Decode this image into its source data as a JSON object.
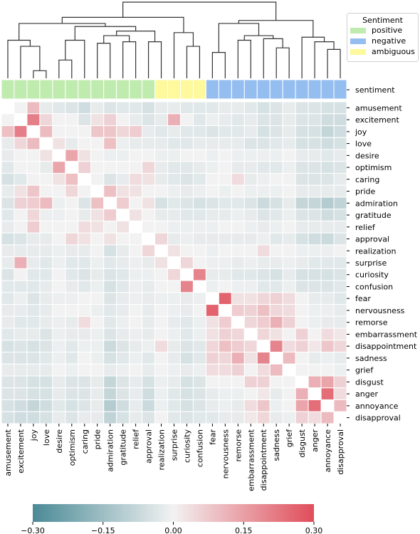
{
  "chart_data": {
    "type": "heatmap",
    "title": "",
    "labels": [
      "amusement",
      "excitement",
      "joy",
      "love",
      "desire",
      "optimism",
      "caring",
      "pride",
      "admiration",
      "gratitude",
      "relief",
      "approval",
      "realization",
      "surprise",
      "curiosity",
      "confusion",
      "fear",
      "nervousness",
      "remorse",
      "embarrassment",
      "disappointment",
      "sadness",
      "grief",
      "disgust",
      "anger",
      "annoyance",
      "disapproval"
    ],
    "row_annotation_label": "sentiment",
    "sentiment": [
      "positive",
      "positive",
      "positive",
      "positive",
      "positive",
      "positive",
      "positive",
      "positive",
      "positive",
      "positive",
      "positive",
      "positive",
      "ambiguous",
      "ambiguous",
      "ambiguous",
      "ambiguous",
      "negative",
      "negative",
      "negative",
      "negative",
      "negative",
      "negative",
      "negative",
      "negative",
      "negative",
      "negative",
      "negative"
    ],
    "legend": {
      "title": "Sentiment",
      "placement": "top-right",
      "entries": [
        {
          "label": "positive",
          "color": "#c0ebae"
        },
        {
          "label": "negative",
          "color": "#94bdf0"
        },
        {
          "label": "ambiguous",
          "color": "#fdf99c"
        }
      ]
    },
    "colorbar": {
      "vmin": -0.3,
      "vmax": 0.3,
      "ticks": [
        "−0.30",
        "−0.15",
        "0.00",
        "0.15",
        "0.30"
      ],
      "tick_values": [
        -0.3,
        -0.15,
        0.0,
        0.15,
        0.3
      ],
      "low_color": "#4a8a96",
      "mid_color": "#f2f2f2",
      "high_color": "#e04d5a",
      "placement": "bottom"
    },
    "diagonal_masked": true,
    "matrix": [
      [
        null,
        0.0,
        0.1,
        -0.02,
        -0.03,
        -0.04,
        -0.06,
        -0.02,
        -0.04,
        -0.03,
        -0.03,
        -0.05,
        -0.02,
        -0.02,
        -0.03,
        -0.03,
        -0.03,
        -0.02,
        -0.02,
        -0.03,
        -0.05,
        -0.04,
        -0.02,
        -0.04,
        -0.04,
        -0.05,
        -0.05
      ],
      [
        0.0,
        null,
        0.21,
        0.05,
        0.0,
        0.0,
        -0.04,
        0.03,
        0.06,
        0.0,
        -0.02,
        -0.04,
        -0.02,
        0.12,
        0.0,
        -0.03,
        -0.01,
        -0.02,
        -0.03,
        -0.02,
        -0.04,
        -0.04,
        -0.02,
        -0.04,
        -0.04,
        -0.06,
        -0.06
      ],
      [
        0.09,
        0.21,
        null,
        0.1,
        0.0,
        0.0,
        0.0,
        0.08,
        0.08,
        0.05,
        0.07,
        -0.02,
        -0.03,
        -0.02,
        -0.03,
        -0.03,
        -0.04,
        -0.03,
        -0.03,
        -0.02,
        -0.05,
        -0.04,
        -0.02,
        -0.05,
        -0.05,
        -0.08,
        -0.06
      ],
      [
        -0.02,
        0.05,
        0.1,
        null,
        0.03,
        -0.02,
        0.0,
        0.0,
        0.09,
        -0.01,
        -0.02,
        -0.02,
        -0.02,
        -0.03,
        -0.03,
        -0.02,
        -0.02,
        -0.02,
        -0.02,
        -0.04,
        -0.04,
        -0.03,
        -0.02,
        -0.05,
        -0.05,
        -0.06,
        -0.05
      ],
      [
        -0.02,
        0.0,
        0.0,
        0.03,
        null,
        0.14,
        0.03,
        0.0,
        -0.01,
        -0.01,
        0.0,
        0.0,
        -0.01,
        -0.01,
        0.0,
        0.0,
        -0.01,
        0.0,
        -0.01,
        -0.01,
        -0.01,
        -0.01,
        0.0,
        -0.02,
        -0.02,
        -0.03,
        -0.02
      ],
      [
        -0.03,
        0.0,
        0.0,
        -0.02,
        0.14,
        null,
        0.06,
        0.0,
        0.0,
        0.0,
        0.0,
        0.05,
        -0.02,
        -0.03,
        -0.03,
        -0.02,
        -0.01,
        0.0,
        -0.02,
        -0.02,
        -0.03,
        -0.03,
        -0.01,
        -0.04,
        -0.04,
        -0.05,
        -0.04
      ],
      [
        -0.05,
        -0.03,
        0.0,
        0.0,
        0.03,
        0.09,
        null,
        0.0,
        -0.04,
        -0.02,
        0.04,
        0.03,
        -0.02,
        -0.03,
        -0.04,
        -0.03,
        0.0,
        0.0,
        0.04,
        -0.02,
        -0.01,
        0.0,
        0.0,
        -0.04,
        -0.04,
        -0.04,
        -0.02
      ],
      [
        -0.02,
        0.03,
        0.08,
        0.0,
        0.0,
        0.05,
        0.0,
        null,
        0.09,
        0.03,
        0.03,
        0.0,
        0.0,
        -0.01,
        -0.02,
        -0.01,
        0.0,
        -0.01,
        0.0,
        -0.01,
        -0.01,
        -0.01,
        0.0,
        -0.02,
        -0.02,
        -0.02,
        -0.02
      ],
      [
        -0.04,
        0.06,
        0.07,
        0.1,
        -0.01,
        0.0,
        -0.04,
        0.09,
        null,
        0.07,
        0.0,
        0.03,
        -0.05,
        -0.03,
        -0.04,
        -0.05,
        -0.04,
        -0.03,
        -0.03,
        -0.04,
        -0.07,
        -0.05,
        -0.02,
        -0.08,
        -0.08,
        -0.11,
        -0.09
      ],
      [
        -0.03,
        0.0,
        0.05,
        -0.01,
        -0.01,
        0.0,
        -0.02,
        0.03,
        0.07,
        null,
        0.03,
        0.0,
        -0.02,
        -0.02,
        -0.03,
        -0.03,
        -0.02,
        -0.02,
        -0.01,
        -0.02,
        -0.04,
        -0.03,
        -0.01,
        -0.04,
        -0.04,
        -0.06,
        -0.05
      ],
      [
        -0.02,
        0.0,
        0.07,
        0.0,
        0.0,
        0.0,
        0.04,
        0.03,
        0.0,
        0.03,
        null,
        0.0,
        0.0,
        -0.01,
        -0.01,
        -0.01,
        -0.01,
        0.0,
        0.0,
        -0.01,
        -0.02,
        -0.01,
        0.0,
        -0.02,
        -0.02,
        -0.02,
        -0.02
      ],
      [
        -0.05,
        -0.04,
        -0.02,
        -0.02,
        0.0,
        0.05,
        0.03,
        0.0,
        0.03,
        0.0,
        0.0,
        null,
        0.05,
        -0.02,
        -0.01,
        -0.02,
        -0.02,
        -0.02,
        -0.02,
        -0.02,
        -0.01,
        -0.03,
        -0.02,
        -0.05,
        -0.06,
        -0.07,
        -0.04
      ],
      [
        -0.02,
        -0.02,
        -0.02,
        -0.02,
        -0.01,
        -0.02,
        -0.02,
        0.0,
        -0.05,
        -0.02,
        0.0,
        0.05,
        null,
        0.03,
        0.0,
        0.0,
        -0.01,
        0.0,
        0.0,
        0.0,
        0.04,
        0.0,
        0.0,
        -0.01,
        -0.01,
        -0.01,
        0.0
      ],
      [
        -0.02,
        0.12,
        -0.02,
        -0.03,
        -0.01,
        -0.03,
        -0.03,
        -0.01,
        -0.03,
        -0.02,
        -0.01,
        -0.02,
        0.03,
        null,
        0.05,
        0.0,
        -0.01,
        -0.01,
        -0.02,
        -0.01,
        -0.02,
        -0.02,
        -0.01,
        -0.02,
        -0.03,
        -0.03,
        -0.03
      ],
      [
        -0.04,
        0.0,
        -0.03,
        -0.03,
        0.0,
        -0.03,
        -0.04,
        -0.02,
        -0.04,
        -0.03,
        -0.01,
        -0.01,
        0.0,
        0.05,
        null,
        0.2,
        -0.02,
        -0.02,
        -0.03,
        -0.03,
        -0.04,
        -0.05,
        -0.02,
        -0.05,
        -0.05,
        -0.05,
        -0.04
      ],
      [
        -0.03,
        -0.03,
        -0.03,
        -0.02,
        0.0,
        -0.02,
        -0.03,
        -0.01,
        -0.05,
        -0.03,
        -0.01,
        -0.02,
        0.0,
        0.0,
        0.2,
        null,
        -0.01,
        0.0,
        -0.01,
        -0.01,
        -0.03,
        -0.03,
        -0.01,
        -0.04,
        -0.04,
        -0.04,
        -0.03
      ],
      [
        -0.03,
        -0.01,
        -0.04,
        -0.02,
        -0.01,
        -0.01,
        0.0,
        0.0,
        -0.04,
        -0.02,
        -0.01,
        -0.02,
        -0.01,
        -0.01,
        -0.02,
        -0.01,
        null,
        0.26,
        0.03,
        0.03,
        0.05,
        0.06,
        0.04,
        0.0,
        -0.02,
        -0.02,
        -0.03
      ],
      [
        -0.02,
        -0.02,
        -0.03,
        -0.02,
        0.0,
        0.0,
        0.0,
        -0.01,
        -0.03,
        -0.02,
        0.0,
        -0.02,
        0.0,
        -0.01,
        -0.02,
        0.0,
        0.26,
        null,
        0.07,
        0.06,
        0.09,
        0.05,
        0.04,
        0.0,
        -0.01,
        -0.01,
        -0.02
      ],
      [
        -0.02,
        -0.03,
        -0.03,
        -0.02,
        -0.01,
        -0.02,
        0.04,
        0.0,
        -0.03,
        -0.01,
        0.0,
        -0.02,
        0.0,
        -0.02,
        -0.03,
        -0.01,
        0.03,
        0.07,
        null,
        0.05,
        0.07,
        0.12,
        0.06,
        0.0,
        -0.01,
        -0.02,
        -0.02
      ],
      [
        -0.03,
        -0.02,
        -0.02,
        -0.04,
        -0.01,
        -0.02,
        -0.02,
        -0.01,
        -0.04,
        -0.02,
        -0.01,
        -0.02,
        0.0,
        -0.01,
        -0.03,
        -0.01,
        0.03,
        0.06,
        0.05,
        null,
        0.05,
        0.03,
        0.0,
        0.06,
        0.0,
        0.04,
        0.02
      ],
      [
        -0.05,
        -0.04,
        -0.05,
        -0.04,
        -0.01,
        -0.03,
        -0.01,
        -0.01,
        -0.07,
        -0.04,
        -0.02,
        -0.01,
        0.04,
        -0.02,
        -0.04,
        -0.03,
        0.05,
        0.09,
        0.07,
        0.05,
        null,
        0.2,
        0.04,
        0.06,
        0.02,
        0.08,
        0.05
      ],
      [
        -0.04,
        -0.04,
        -0.04,
        -0.03,
        -0.01,
        -0.03,
        0.0,
        -0.01,
        -0.05,
        -0.03,
        -0.01,
        -0.03,
        0.0,
        -0.02,
        -0.05,
        -0.03,
        0.06,
        0.05,
        0.12,
        0.03,
        0.2,
        null,
        0.1,
        0.0,
        -0.02,
        -0.01,
        -0.02
      ],
      [
        -0.02,
        -0.02,
        -0.02,
        -0.02,
        0.0,
        -0.01,
        0.0,
        0.0,
        -0.02,
        -0.01,
        0.0,
        -0.02,
        0.0,
        -0.01,
        -0.02,
        -0.01,
        0.04,
        0.04,
        0.06,
        0.0,
        0.04,
        0.1,
        null,
        0.0,
        0.0,
        0.0,
        -0.01
      ],
      [
        -0.04,
        -0.04,
        -0.05,
        -0.05,
        -0.02,
        -0.04,
        -0.04,
        -0.02,
        -0.08,
        -0.04,
        -0.02,
        -0.05,
        -0.01,
        -0.02,
        -0.05,
        -0.04,
        0.0,
        0.0,
        0.0,
        0.06,
        0.06,
        0.0,
        0.0,
        null,
        0.12,
        0.14,
        0.06
      ],
      [
        -0.04,
        -0.04,
        -0.05,
        -0.05,
        -0.02,
        -0.04,
        -0.04,
        -0.02,
        -0.08,
        -0.04,
        -0.02,
        -0.06,
        -0.01,
        -0.03,
        -0.05,
        -0.04,
        -0.02,
        -0.01,
        -0.01,
        0.0,
        0.02,
        -0.02,
        0.0,
        0.12,
        null,
        0.24,
        0.04
      ],
      [
        -0.05,
        -0.06,
        -0.08,
        -0.06,
        -0.03,
        -0.05,
        -0.04,
        -0.02,
        -0.11,
        -0.06,
        -0.02,
        -0.07,
        -0.01,
        -0.03,
        -0.05,
        -0.04,
        -0.02,
        -0.01,
        -0.02,
        0.04,
        0.08,
        -0.01,
        0.0,
        0.14,
        0.24,
        null,
        0.1
      ],
      [
        -0.05,
        -0.06,
        -0.06,
        -0.05,
        -0.02,
        -0.04,
        -0.02,
        -0.02,
        -0.09,
        -0.05,
        -0.02,
        -0.04,
        0.0,
        -0.03,
        -0.04,
        -0.03,
        -0.03,
        -0.02,
        -0.02,
        0.02,
        0.05,
        -0.02,
        -0.01,
        0.06,
        0.04,
        0.1,
        null
      ]
    ],
    "dendrogram": {
      "description": "hierarchical clustering tree over columns",
      "links": [
        {
          "a": "joy",
          "b": "love",
          "height": 0.55
        },
        {
          "a": "excitement",
          "b": "[joy,love]",
          "height": 0.71
        },
        {
          "a": "amusement",
          "b": "[excitement,joy,love]",
          "height": 0.75
        },
        {
          "a": "desire",
          "b": "optimism",
          "height": 0.62
        },
        {
          "a": "[desire,optimism]",
          "b": "caring",
          "height": 0.75
        },
        {
          "a": "pride",
          "b": "admiration",
          "height": 0.73
        },
        {
          "a": "gratitude",
          "b": "relief",
          "height": 0.74
        },
        {
          "a": "[pride,admiration]",
          "b": "[gratitude,relief]",
          "height": 0.78
        },
        {
          "a": "approval",
          "b": "realization",
          "height": 0.74
        },
        {
          "a": "[pride..relief]",
          "b": "[approval,realization]",
          "height": 0.81
        },
        {
          "a": "[desire..caring]",
          "b": "[pride..realization]",
          "height": 0.84
        },
        {
          "a": "[amusement..love]",
          "b": "[desire..realization]",
          "height": 0.86
        },
        {
          "a": "curiosity",
          "b": "confusion",
          "height": 0.71
        },
        {
          "a": "surprise",
          "b": "[curiosity,confusion]",
          "height": 0.8
        },
        {
          "a": "[amusement..realization]",
          "b": "[surprise..confusion]",
          "height": 0.9
        },
        {
          "a": "fear",
          "b": "nervousness",
          "height": 0.67
        },
        {
          "a": "remorse",
          "b": "embarrassment",
          "height": 0.75
        },
        {
          "a": "sadness",
          "b": "grief",
          "height": 0.7
        },
        {
          "a": "disappointment",
          "b": "[sadness,grief]",
          "height": 0.76
        },
        {
          "a": "[remorse,embarrassment]",
          "b": "[disappointment..grief]",
          "height": 0.78
        },
        {
          "a": "[fear,nervousness]",
          "b": "[remorse..grief]",
          "height": 0.86
        },
        {
          "a": "annoyance",
          "b": "disapproval",
          "height": 0.69
        },
        {
          "a": "anger",
          "b": "[annoyance,disapproval]",
          "height": 0.74
        },
        {
          "a": "disgust",
          "b": "[anger..disapproval]",
          "height": 0.77
        },
        {
          "a": "[fear..grief]",
          "b": "[disgust..disapproval]",
          "height": 0.88
        },
        {
          "a": "[positive+ambiguous]",
          "b": "[negative]",
          "height": 1.0
        }
      ]
    }
  }
}
